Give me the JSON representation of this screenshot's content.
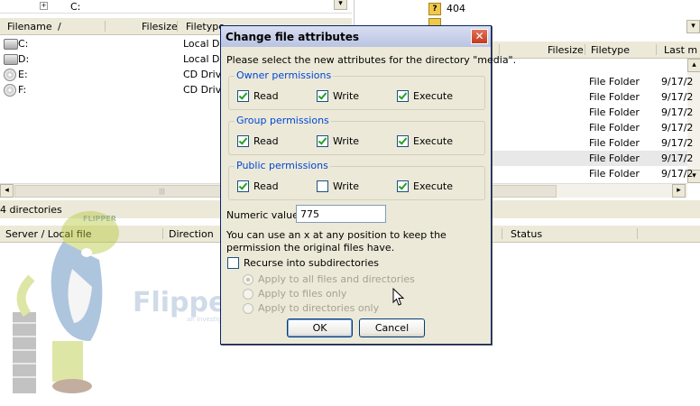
{
  "left_pane": {
    "columns": [
      "Filename",
      "Filesize",
      "Filetype"
    ],
    "sort_indicator": "/",
    "drives": [
      {
        "name": "C:",
        "type": "Local Disk",
        "icon": "hard-drive-icon"
      },
      {
        "name": "D:",
        "type": "Local Disk",
        "icon": "hard-drive-icon"
      },
      {
        "name": "E:",
        "type": "CD Drive",
        "icon": "cd-drive-icon"
      },
      {
        "name": "F:",
        "type": "CD Drive",
        "icon": "cd-drive-icon"
      }
    ],
    "top_tree_item": "C:",
    "status": "4 directories"
  },
  "right_pane": {
    "tree_items": [
      {
        "label": "404",
        "icon": "unknown-folder-icon"
      },
      {
        "label": "???",
        "icon": "unknown-folder-icon"
      }
    ],
    "columns": [
      "Filesize",
      "Filetype",
      "Last m"
    ],
    "rows": [
      {
        "type": "File Folder",
        "date": "9/17/2"
      },
      {
        "type": "File Folder",
        "date": "9/17/2"
      },
      {
        "type": "File Folder",
        "date": "9/17/2"
      },
      {
        "type": "File Folder",
        "date": "9/17/2"
      },
      {
        "type": "File Folder",
        "date": "9/17/2"
      },
      {
        "type": "File Folder",
        "date": "9/17/2"
      },
      {
        "type": "File Folder",
        "date": "9/17/2"
      }
    ]
  },
  "queue": {
    "columns": [
      "Server / Local file",
      "Direction",
      "Status"
    ]
  },
  "dialog": {
    "title": "Change file attributes",
    "prompt": "Please select the new attributes for the directory \"media\".",
    "groups": [
      {
        "label": "Owner permissions",
        "read": true,
        "write": true,
        "execute": true
      },
      {
        "label": "Group permissions",
        "read": true,
        "write": true,
        "execute": true
      },
      {
        "label": "Public permissions",
        "read": true,
        "write": false,
        "execute": true
      }
    ],
    "perm_labels": {
      "read": "Read",
      "write": "Write",
      "execute": "Execute"
    },
    "numeric_label": "Numeric value:",
    "numeric_value": "775",
    "hint": "You can use an x at any position to keep the permission the original files have.",
    "recurse_label": "Recurse into subdirectories",
    "recurse_checked": false,
    "apply_options": [
      {
        "label": "Apply to all files and directories",
        "selected": true
      },
      {
        "label": "Apply to files only",
        "selected": false
      },
      {
        "label": "Apply to directories only",
        "selected": false
      }
    ],
    "ok_label": "OK",
    "cancel_label": "Cancel",
    "close_glyph": "✕"
  },
  "watermark": {
    "brand": "FlipperHost",
    "tagline": "an investigation company",
    "cap_text": "FLIPPER"
  },
  "colors": {
    "accent_blue": "#0046d5",
    "title_grad_top": "#d9dff2",
    "close_red": "#c23a1e",
    "selected_row": "#e8e8e8"
  }
}
